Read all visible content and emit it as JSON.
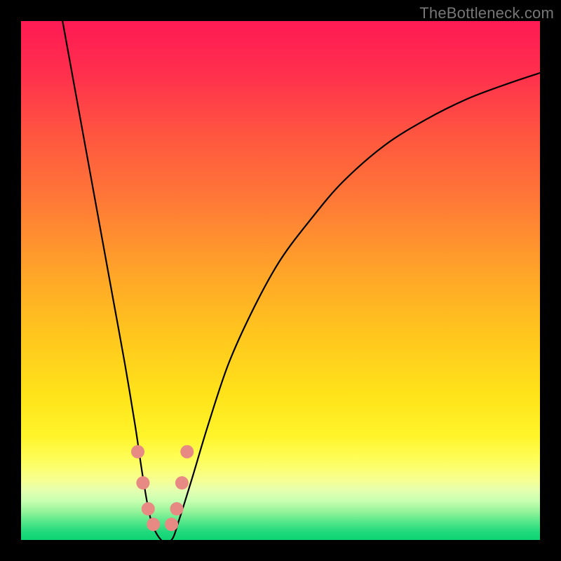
{
  "watermark": "TheBottleneck.com",
  "chart_data": {
    "type": "line",
    "title": "",
    "xlabel": "",
    "ylabel": "",
    "xlim": [
      0,
      100
    ],
    "ylim": [
      0,
      100
    ],
    "series": [
      {
        "name": "bottleneck-curve",
        "x": [
          8,
          10,
          12,
          14,
          16,
          18,
          20,
          22,
          23.5,
          25,
          27,
          29,
          30.5,
          33,
          36,
          40,
          45,
          50,
          56,
          62,
          70,
          78,
          86,
          94,
          100
        ],
        "values": [
          100,
          89,
          78,
          67,
          56,
          45,
          34,
          22,
          12,
          4,
          0,
          0,
          4,
          12,
          22,
          34,
          45,
          54,
          62,
          69,
          76,
          81,
          85,
          88,
          90
        ]
      }
    ],
    "markers": {
      "name": "highlight-dots",
      "color": "#e88a84",
      "points": [
        {
          "x": 22.5,
          "y": 17
        },
        {
          "x": 23.5,
          "y": 11
        },
        {
          "x": 24.5,
          "y": 6
        },
        {
          "x": 25.5,
          "y": 3
        },
        {
          "x": 29.0,
          "y": 3
        },
        {
          "x": 30.0,
          "y": 6
        },
        {
          "x": 31.0,
          "y": 11
        },
        {
          "x": 32.0,
          "y": 17
        }
      ]
    },
    "background_gradient": {
      "stops": [
        {
          "offset": 0.0,
          "color": "#ff1a54"
        },
        {
          "offset": 0.1,
          "color": "#ff2f4d"
        },
        {
          "offset": 0.22,
          "color": "#ff5640"
        },
        {
          "offset": 0.35,
          "color": "#ff7a36"
        },
        {
          "offset": 0.48,
          "color": "#ffa329"
        },
        {
          "offset": 0.6,
          "color": "#ffc51e"
        },
        {
          "offset": 0.72,
          "color": "#ffe31a"
        },
        {
          "offset": 0.8,
          "color": "#fff42a"
        },
        {
          "offset": 0.85,
          "color": "#fdff60"
        },
        {
          "offset": 0.885,
          "color": "#f6ff92"
        },
        {
          "offset": 0.905,
          "color": "#e4ffb0"
        },
        {
          "offset": 0.925,
          "color": "#c7ffb0"
        },
        {
          "offset": 0.945,
          "color": "#96f39a"
        },
        {
          "offset": 0.965,
          "color": "#55e789"
        },
        {
          "offset": 0.985,
          "color": "#1fd97c"
        },
        {
          "offset": 1.0,
          "color": "#0fd474"
        }
      ]
    }
  }
}
